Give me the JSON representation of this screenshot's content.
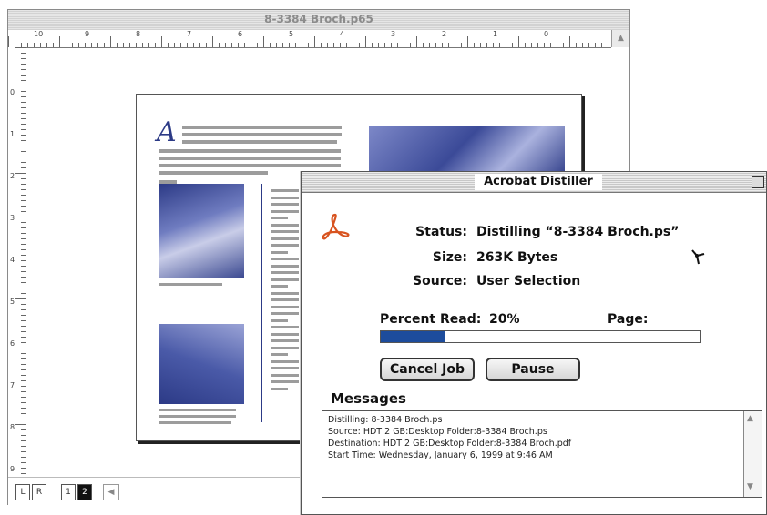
{
  "document_window": {
    "title": "8-3384 Broch.p65",
    "ruler_h_labels": [
      "10",
      "9",
      "8",
      "7",
      "6",
      "5",
      "4",
      "3",
      "2",
      "1",
      "0"
    ],
    "ruler_v_labels": [
      "0",
      "1",
      "2",
      "3",
      "4",
      "5",
      "6",
      "7",
      "8",
      "9"
    ],
    "page_tabs": [
      "L",
      "R",
      "1",
      "2"
    ],
    "scroll_up_icon": "▲",
    "scroll_left_icon": "◀",
    "page_content": {
      "drop_cap": "A",
      "photo_colors": [
        "#4a5aa8",
        "#6f7cc0",
        "#2c3a86"
      ]
    }
  },
  "distiller": {
    "title": "Acrobat Distiller",
    "status_label": "Status:",
    "status_value": "Distilling “8-3384 Broch.ps”",
    "size_label": "Size:",
    "size_value": "263K Bytes",
    "source_label": "Source:",
    "source_value": "User Selection",
    "percent_read_label": "Percent Read:",
    "percent_read_value": "20%",
    "page_label": "Page:",
    "progress_fraction": 0.2,
    "cancel_button": "Cancel Job",
    "pause_button": "Pause",
    "messages_label": "Messages",
    "messages": [
      "Distilling: 8-3384 Broch.ps",
      "Source: HDT 2 GB:Desktop Folder:8-3384 Broch.ps",
      "Destination: HDT 2 GB:Desktop Folder:8-3384 Broch.pdf",
      "Start Time: Wednesday, January 6, 1999 at 9:46 AM"
    ],
    "accent_color": "#1d4c9c",
    "acrobat_icon_color": "#d8531f"
  }
}
